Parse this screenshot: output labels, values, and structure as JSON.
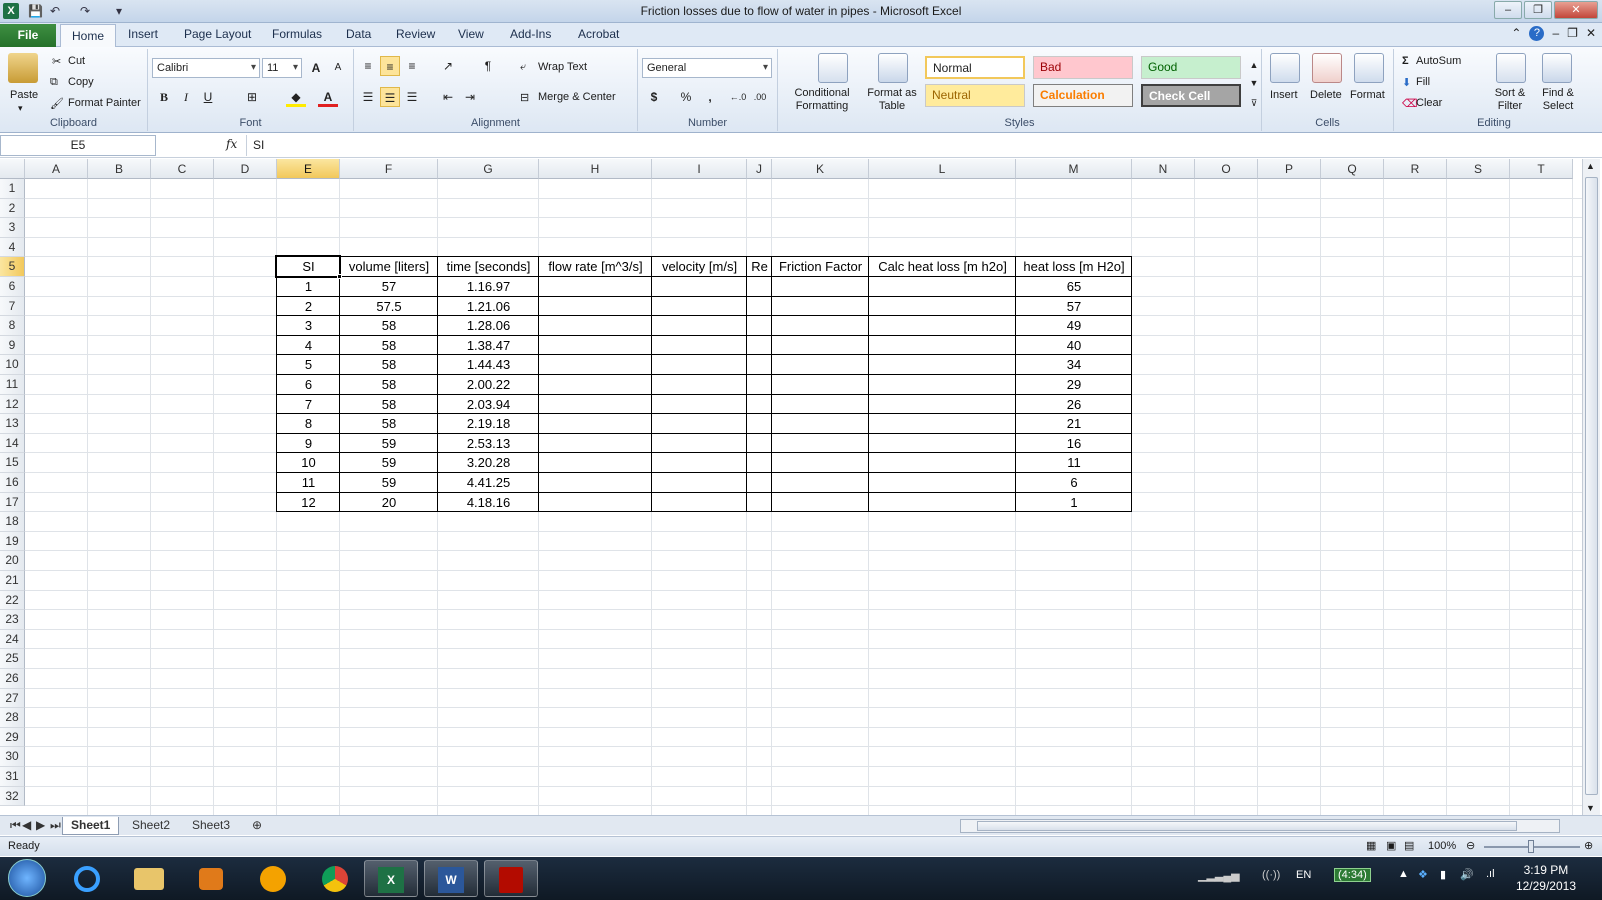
{
  "window": {
    "title": "Friction losses due to flow of water in pipes  -  Microsoft Excel",
    "minimize_glyph": "–",
    "restore_glyph": "❐",
    "close_glyph": "✕"
  },
  "ribbon_tabs": [
    "File",
    "Home",
    "Insert",
    "Page Layout",
    "Formulas",
    "Data",
    "Review",
    "View",
    "Add-Ins",
    "Acrobat"
  ],
  "clipboard": {
    "paste": "Paste",
    "cut": "Cut",
    "copy": "Copy",
    "format_painter": "Format Painter",
    "label": "Clipboard"
  },
  "font": {
    "name": "Calibri",
    "size": "11",
    "bold": "B",
    "italic": "I",
    "underline": "U",
    "grow": "A",
    "shrink": "A",
    "label": "Font"
  },
  "alignment": {
    "wrap_text": "Wrap Text",
    "merge_center": "Merge & Center",
    "label": "Alignment"
  },
  "number": {
    "format": "General",
    "currency": "$",
    "percent": "%",
    "comma": ",",
    "inc_dec": "←.0",
    "dec_dec": ".00",
    "label": "Number"
  },
  "styles": {
    "conditional": "Conditional Formatting",
    "format_table": "Format as Table",
    "normal": "Normal",
    "bad": "Bad",
    "good": "Good",
    "neutral": "Neutral",
    "calculation": "Calculation",
    "check_cell": "Check Cell",
    "label": "Styles"
  },
  "cells": {
    "insert": "Insert",
    "delete": "Delete",
    "format": "Format",
    "label": "Cells"
  },
  "editing": {
    "autosum": "AutoSum",
    "fill": "Fill",
    "clear": "Clear",
    "sort_filter": "Sort & Filter",
    "find_select": "Find & Select",
    "label": "Editing"
  },
  "formula_bar": {
    "name_box": "E5",
    "fx": "fx",
    "content": "SI"
  },
  "grid": {
    "columns": [
      "A",
      "B",
      "C",
      "D",
      "E",
      "F",
      "G",
      "H",
      "I",
      "J",
      "K",
      "L",
      "M",
      "N",
      "O",
      "P",
      "Q",
      "R",
      "S",
      "T"
    ],
    "active_column": "E",
    "rows": [
      "1",
      "2",
      "3",
      "4",
      "5",
      "6",
      "7",
      "8",
      "9",
      "10",
      "11",
      "12",
      "13",
      "14",
      "15",
      "16",
      "17",
      "18",
      "19",
      "20",
      "21",
      "22",
      "23",
      "24",
      "25",
      "26",
      "27",
      "28",
      "29",
      "30",
      "31",
      "32"
    ],
    "active_row": "5"
  },
  "table": {
    "headers": [
      "SI",
      "volume [liters]",
      "time [seconds]",
      "flow rate [m^3/s]",
      "velocity [m/s]",
      "Re",
      "Friction Factor",
      "Calc heat loss [m h2o]",
      "heat loss [m H2o]"
    ],
    "rows": [
      [
        "1",
        "57",
        "1.16.97",
        "",
        "",
        "",
        "",
        "",
        "65"
      ],
      [
        "2",
        "57.5",
        "1.21.06",
        "",
        "",
        "",
        "",
        "",
        "57"
      ],
      [
        "3",
        "58",
        "1.28.06",
        "",
        "",
        "",
        "",
        "",
        "49"
      ],
      [
        "4",
        "58",
        "1.38.47",
        "",
        "",
        "",
        "",
        "",
        "40"
      ],
      [
        "5",
        "58",
        "1.44.43",
        "",
        "",
        "",
        "",
        "",
        "34"
      ],
      [
        "6",
        "58",
        "2.00.22",
        "",
        "",
        "",
        "",
        "",
        "29"
      ],
      [
        "7",
        "58",
        "2.03.94",
        "",
        "",
        "",
        "",
        "",
        "26"
      ],
      [
        "8",
        "58",
        "2.19.18",
        "",
        "",
        "",
        "",
        "",
        "21"
      ],
      [
        "9",
        "59",
        "2.53.13",
        "",
        "",
        "",
        "",
        "",
        "16"
      ],
      [
        "10",
        "59",
        "3.20.28",
        "",
        "",
        "",
        "",
        "",
        "11"
      ],
      [
        "11",
        "59",
        "4.41.25",
        "",
        "",
        "",
        "",
        "",
        "6"
      ],
      [
        "12",
        "20",
        "4.18.16",
        "",
        "",
        "",
        "",
        "",
        "1"
      ]
    ]
  },
  "sheets": [
    "Sheet1",
    "Sheet2",
    "Sheet3"
  ],
  "active_sheet": "Sheet1",
  "status": {
    "ready": "Ready",
    "zoom": "100%"
  },
  "taskbar": {
    "language": "EN",
    "battery": "(4:34)",
    "time": "3:19 PM",
    "date": "12/29/2013"
  },
  "colors": {
    "excel_green": "#1e7145",
    "selection_header": "#f2c85b",
    "check_cell": "#a5a5a5",
    "bad_fill": "#ffc7ce",
    "good_fill": "#c6efce",
    "neutral_fill": "#ffeb9c"
  }
}
